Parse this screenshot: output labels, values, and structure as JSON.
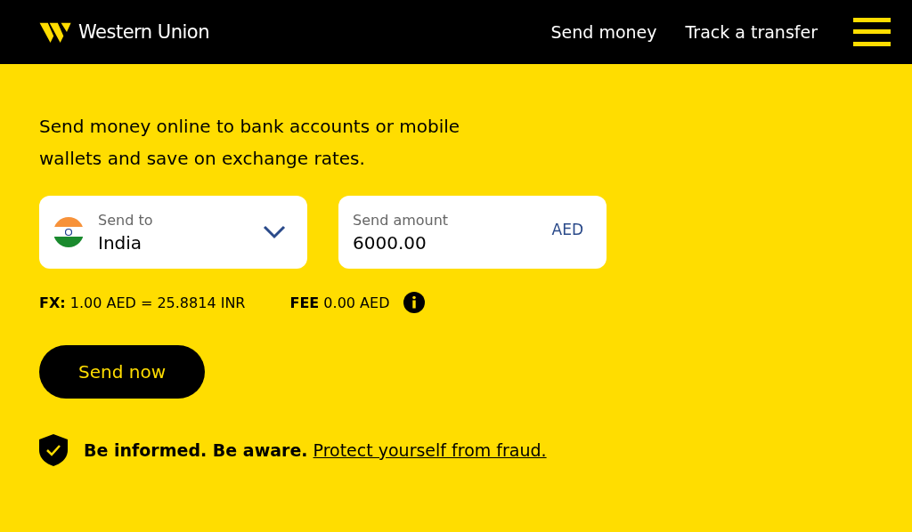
{
  "header": {
    "brand": "Western Union",
    "nav": [
      "Send money",
      "Track a transfer"
    ]
  },
  "intro": "Send money online to bank accounts or mobile wallets and save on exchange rates.",
  "send_to": {
    "label": "Send to",
    "value": "India"
  },
  "send_amount": {
    "label": "Send amount",
    "value": "6000.00",
    "currency": "AED"
  },
  "fx": "**FX:** 1.00 AED = 25.8814 INR",
  "fee": "**FEE** 0.00 AED",
  "button": "Send now",
  "notice": {
    "text": "Be informed. Be aware.",
    "link": "Protect yourself from fraud."
  }
}
